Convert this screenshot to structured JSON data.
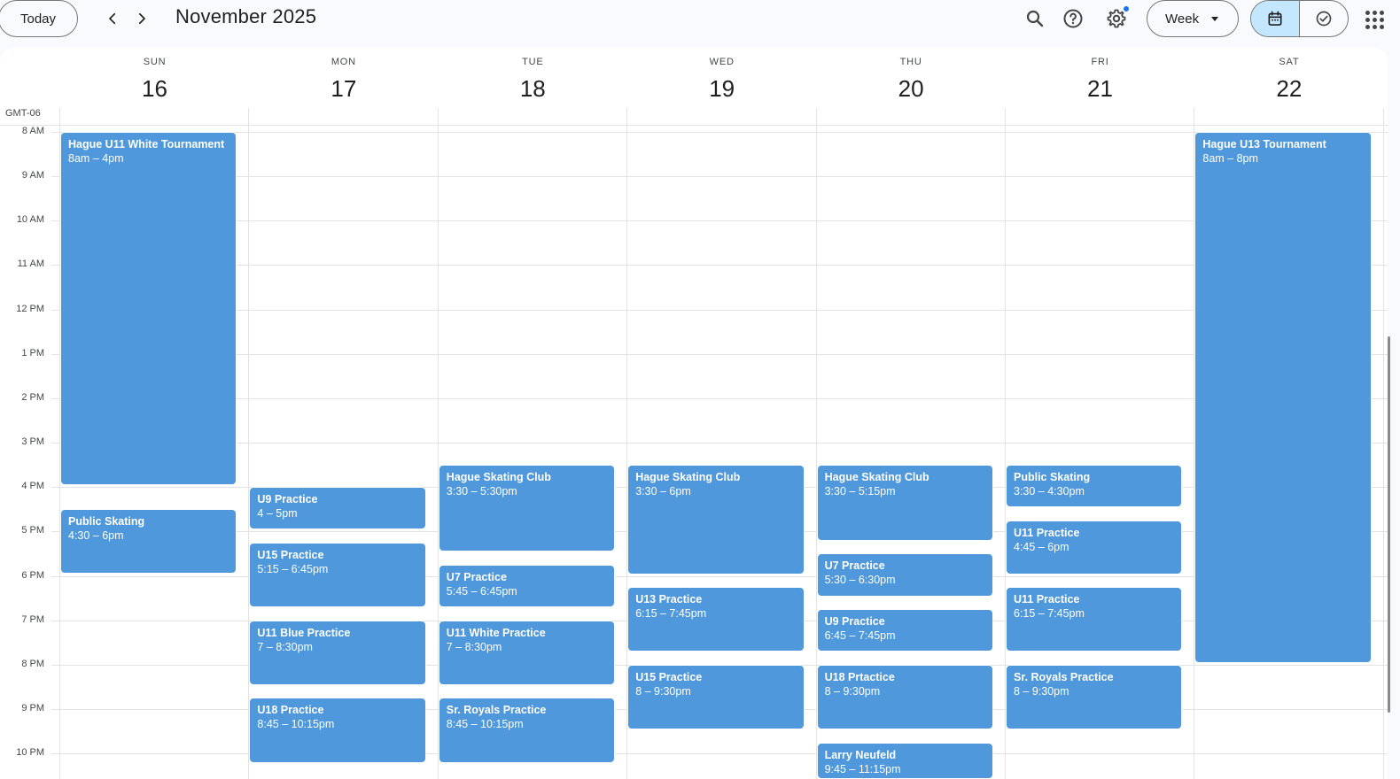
{
  "header": {
    "today_label": "Today",
    "month_title": "November 2025",
    "view_label": "Week",
    "icons": [
      "chevron-left-icon",
      "chevron-right-icon",
      "search-icon",
      "help-icon",
      "settings-icon",
      "calendar-icon",
      "tasks-check-icon",
      "apps-grid-icon"
    ],
    "accent_color": "#c2e7ff",
    "notification_dot_color": "#1a73e8"
  },
  "calendar": {
    "timezone": "GMT-06",
    "days": [
      {
        "dow": "SUN",
        "date": "16"
      },
      {
        "dow": "MON",
        "date": "17"
      },
      {
        "dow": "TUE",
        "date": "18"
      },
      {
        "dow": "WED",
        "date": "19"
      },
      {
        "dow": "THU",
        "date": "20"
      },
      {
        "dow": "FRI",
        "date": "21"
      },
      {
        "dow": "SAT",
        "date": "22"
      }
    ],
    "hours": [
      "8 AM",
      "9 AM",
      "10 AM",
      "11 AM",
      "12 PM",
      "1 PM",
      "2 PM",
      "3 PM",
      "4 PM",
      "5 PM",
      "6 PM",
      "7 PM",
      "8 PM",
      "9 PM",
      "10 PM"
    ],
    "event_color": "#4f98dc",
    "events": [
      {
        "day": 0,
        "title": "Hague U11 White Tournament",
        "time": "8am – 4pm",
        "start": 8.0,
        "end": 16.0
      },
      {
        "day": 0,
        "title": "Public Skating",
        "time": "4:30 – 6pm",
        "start": 16.5,
        "end": 18.0
      },
      {
        "day": 1,
        "title": "U9 Practice",
        "time": "4 – 5pm",
        "start": 16.0,
        "end": 17.0
      },
      {
        "day": 1,
        "title": "U15 Practice",
        "time": "5:15 – 6:45pm",
        "start": 17.25,
        "end": 18.75
      },
      {
        "day": 1,
        "title": "U11 Blue Practice",
        "time": "7 – 8:30pm",
        "start": 19.0,
        "end": 20.5
      },
      {
        "day": 1,
        "title": "U18 Practice",
        "time": "8:45 – 10:15pm",
        "start": 20.75,
        "end": 22.25
      },
      {
        "day": 2,
        "title": "Hague Skating Club",
        "time": "3:30 – 5:30pm",
        "start": 15.5,
        "end": 17.5
      },
      {
        "day": 2,
        "title": "U7 Practice",
        "time": "5:45 – 6:45pm",
        "start": 17.75,
        "end": 18.75
      },
      {
        "day": 2,
        "title": "U11 White Practice",
        "time": "7 – 8:30pm",
        "start": 19.0,
        "end": 20.5
      },
      {
        "day": 2,
        "title": "Sr. Royals Practice",
        "time": "8:45 – 10:15pm",
        "start": 20.75,
        "end": 22.25
      },
      {
        "day": 3,
        "title": "Hague Skating Club",
        "time": "3:30 – 6pm",
        "start": 15.5,
        "end": 18.0
      },
      {
        "day": 3,
        "title": "U13 Practice",
        "time": "6:15 – 7:45pm",
        "start": 18.25,
        "end": 19.75
      },
      {
        "day": 3,
        "title": "U15 Practice",
        "time": "8 – 9:30pm",
        "start": 20.0,
        "end": 21.5
      },
      {
        "day": 4,
        "title": "Hague Skating Club",
        "time": "3:30 – 5:15pm",
        "start": 15.5,
        "end": 17.25
      },
      {
        "day": 4,
        "title": "U7 Practice",
        "time": "5:30 – 6:30pm",
        "start": 17.5,
        "end": 18.5
      },
      {
        "day": 4,
        "title": "U9 Practice",
        "time": "6:45 – 7:45pm",
        "start": 18.75,
        "end": 19.75
      },
      {
        "day": 4,
        "title": "U18 Prtactice",
        "time": "8 – 9:30pm",
        "start": 20.0,
        "end": 21.5
      },
      {
        "day": 4,
        "title": "Larry Neufeld",
        "time": "9:45 – 11:15pm",
        "start": 21.75,
        "end": 23.25
      },
      {
        "day": 5,
        "title": "Public Skating",
        "time": "3:30 – 4:30pm",
        "start": 15.5,
        "end": 16.5
      },
      {
        "day": 5,
        "title": "U11 Practice",
        "time": "4:45 – 6pm",
        "start": 16.75,
        "end": 18.0
      },
      {
        "day": 5,
        "title": "U11 Practice",
        "time": "6:15 – 7:45pm",
        "start": 18.25,
        "end": 19.75
      },
      {
        "day": 5,
        "title": "Sr. Royals Practice",
        "time": "8 – 9:30pm",
        "start": 20.0,
        "end": 21.5
      },
      {
        "day": 6,
        "title": "Hague U13 Tournament",
        "time": "8am – 8pm",
        "start": 8.0,
        "end": 20.0
      }
    ]
  }
}
